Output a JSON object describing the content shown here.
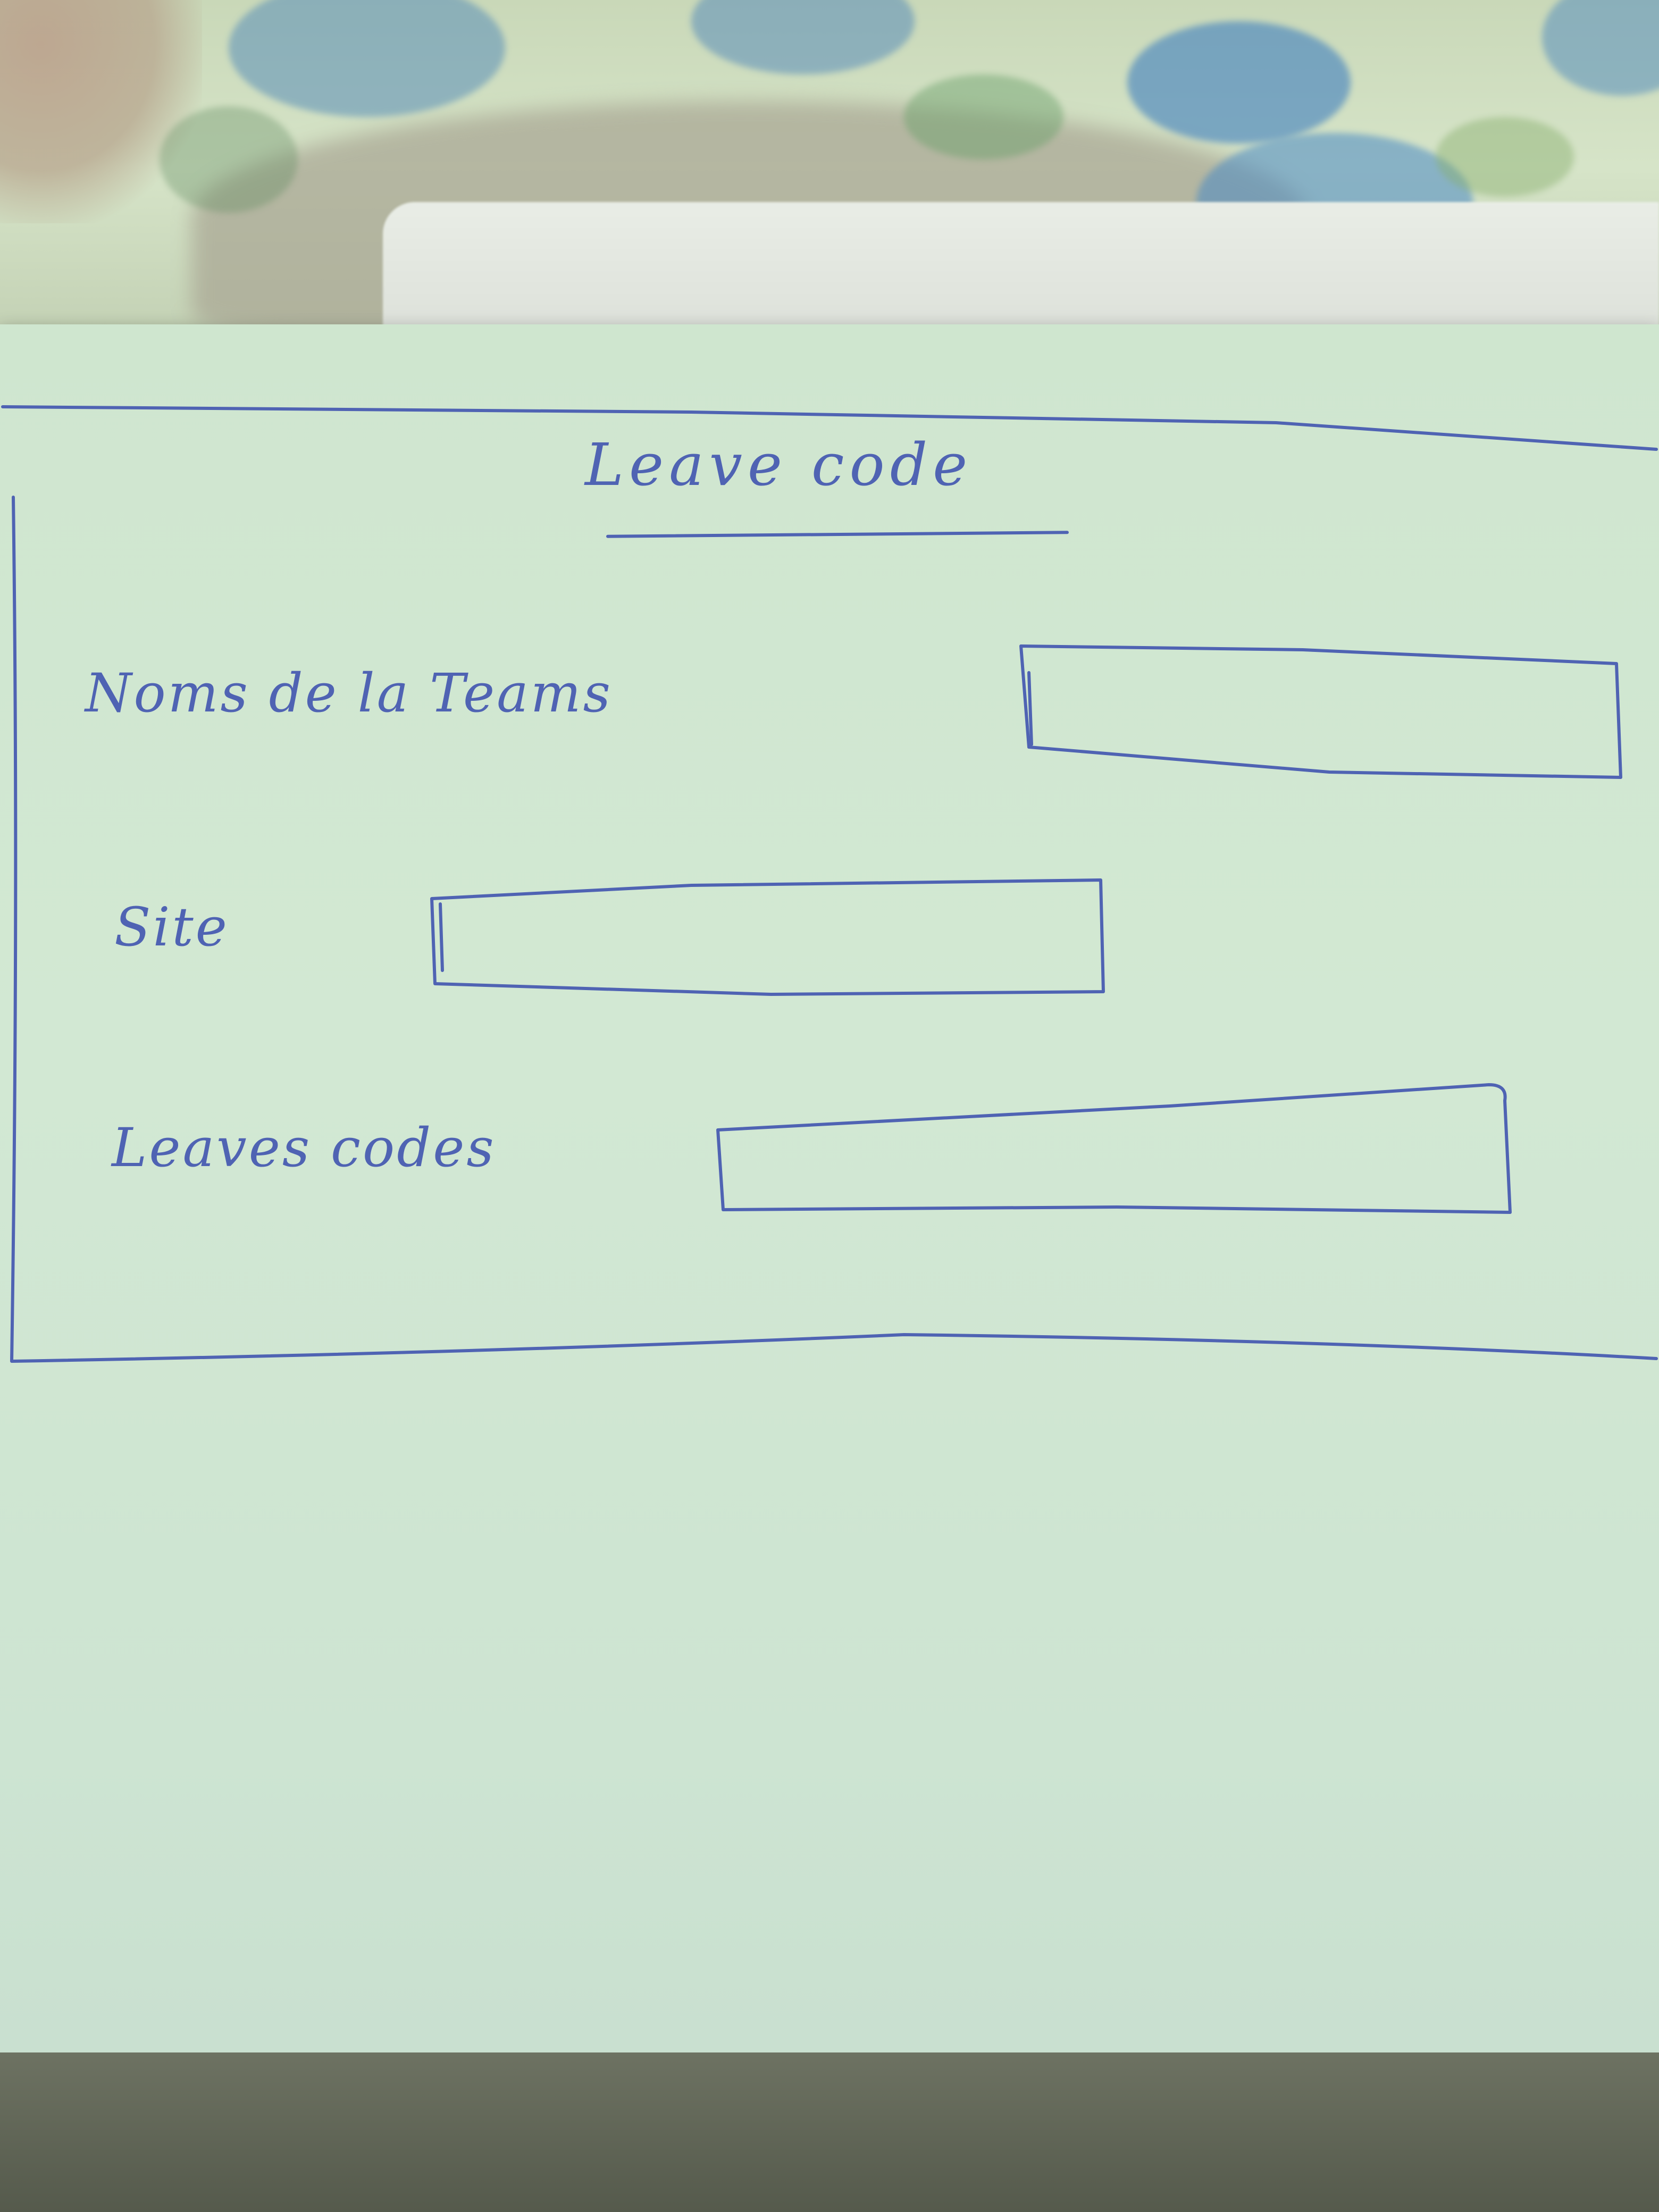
{
  "form": {
    "title": "Leave code",
    "fields": [
      {
        "label": "Noms de la Teams",
        "value": "",
        "placeholder": ""
      },
      {
        "label": "Site",
        "value": "",
        "placeholder": ""
      },
      {
        "label": "Leaves codes",
        "value": "",
        "placeholder": ""
      }
    ]
  },
  "colors": {
    "ink": "#4f63b3",
    "paper": "#d2e8d3"
  }
}
